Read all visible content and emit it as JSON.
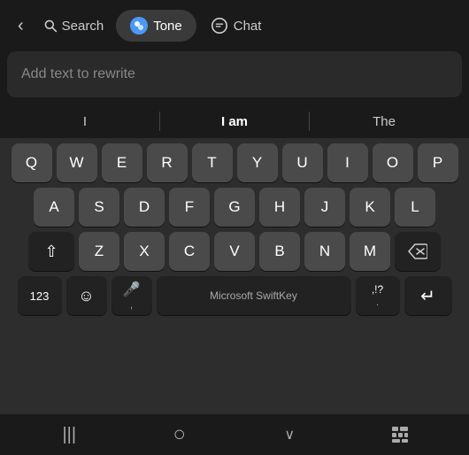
{
  "nav": {
    "back_label": "‹",
    "search_label": "Search",
    "tone_label": "Tone",
    "chat_label": "Chat"
  },
  "input": {
    "placeholder": "Add text to rewrite"
  },
  "autocomplete": {
    "items": [
      {
        "id": "left",
        "text": "I",
        "bold": false
      },
      {
        "id": "middle",
        "text": "I am",
        "bold": true
      },
      {
        "id": "right",
        "text": "The",
        "bold": false
      }
    ]
  },
  "keyboard": {
    "rows": [
      [
        "Q",
        "W",
        "E",
        "R",
        "T",
        "Y",
        "U",
        "I",
        "O",
        "P"
      ],
      [
        "A",
        "S",
        "D",
        "F",
        "G",
        "H",
        "J",
        "K",
        "L"
      ],
      [
        "⇧",
        "Z",
        "X",
        "C",
        "V",
        "B",
        "N",
        "M",
        "⌫"
      ]
    ],
    "bottom_row": {
      "nums_label": "123",
      "emoji_label": "☺",
      "mic_label": "🎤",
      "comma_label": ",",
      "space_label": "Microsoft SwiftKey",
      "punctuation_label": ",!?",
      "period_label": ".",
      "enter_label": "↵"
    }
  },
  "bottom_bar": {
    "menu_icon": "|||",
    "home_icon": "○",
    "back_icon": "∨",
    "apps_icon": "⠿"
  },
  "colors": {
    "accent": "#4a9af5",
    "bg_dark": "#1a1a1a",
    "bg_mid": "#2a2a2a",
    "key_bg": "#4a4a4a",
    "key_dark": "#222222"
  }
}
